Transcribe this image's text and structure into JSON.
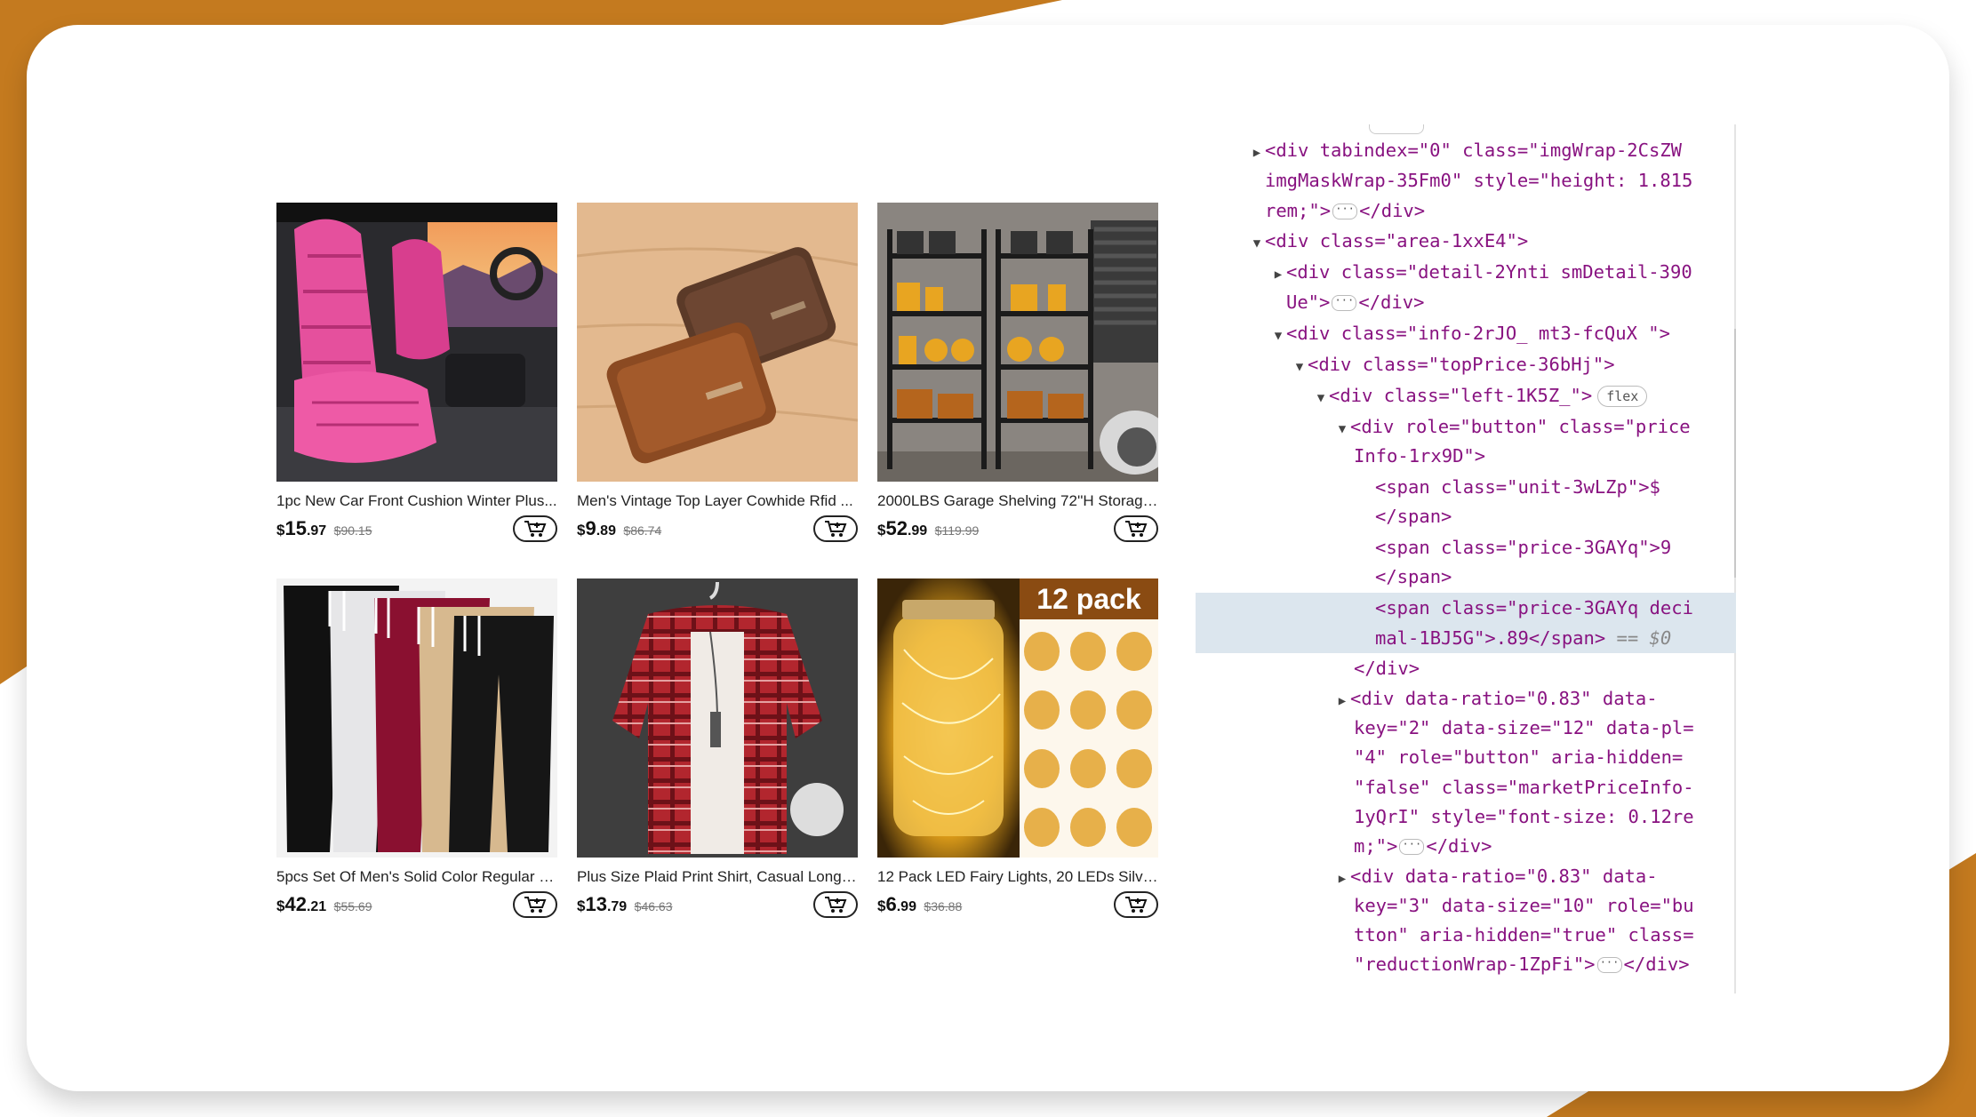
{
  "products": [
    {
      "title": "1pc New Car Front Cushion Winter Plus...",
      "currency": "$",
      "price_int": "15",
      "price_dec": ".97",
      "old_price": "$90.15"
    },
    {
      "title": "Men's Vintage Top Layer Cowhide Rfid ...",
      "currency": "$",
      "price_int": "9",
      "price_dec": ".89",
      "old_price": "$86.74"
    },
    {
      "title": "2000LBS Garage Shelving 72''H Storage...",
      "currency": "$",
      "price_int": "52",
      "price_dec": ".99",
      "old_price": "$119.99"
    },
    {
      "title": "5pcs Set Of Men's Solid Color Regular F...",
      "currency": "$",
      "price_int": "42",
      "price_dec": ".21",
      "old_price": "$55.69"
    },
    {
      "title": "Plus Size Plaid Print Shirt, Casual Long S...",
      "currency": "$",
      "price_int": "13",
      "price_dec": ".79",
      "old_price": "$46.63"
    },
    {
      "title": "12 Pack LED Fairy Lights, 20 LEDs Silver...",
      "currency": "$",
      "price_int": "6",
      "price_dec": ".99",
      "old_price": "$36.88",
      "badge": "12 pack"
    }
  ],
  "devtools": {
    "lines": [
      {
        "t": "<div tabindex=\"0\" class=\"imgWrap-2CsZW"
      },
      {
        "t": "imgMaskWrap-35Fm0\" style=\"height: 1.815"
      },
      {
        "t": "rem;\">"
      },
      {
        "t": "</div>"
      },
      {
        "t": "<div class=\"area-1xxE4\">"
      },
      {
        "t": "<div class=\"detail-2Ynti smDetail-390"
      },
      {
        "t": "Ue\">"
      },
      {
        "t": "</div>"
      },
      {
        "t": "<div class=\"info-2rJO_ mt3-fcQuX \">"
      },
      {
        "t": "<div class=\"topPrice-36bHj\">"
      },
      {
        "t": "<div class=\"left-1K5Z_\">"
      },
      {
        "t": "flex"
      },
      {
        "t": "<div role=\"button\" class=\"price"
      },
      {
        "t": "Info-1rx9D\">"
      },
      {
        "t": "<span class=\"unit-3wLZp\">$"
      },
      {
        "t": "</span>"
      },
      {
        "t": "<span class=\"price-3GAYq\">9"
      },
      {
        "t": "</span>"
      },
      {
        "t": "<span class=\"price-3GAYq deci"
      },
      {
        "t": "mal-1BJ5G\">.89</span>"
      },
      {
        "t": "== $0"
      },
      {
        "t": "</div>"
      },
      {
        "t": "<div data-ratio=\"0.83\" data-"
      },
      {
        "t": "key=\"2\" data-size=\"12\" data-pl="
      },
      {
        "t": "\"4\" role=\"button\" aria-hidden="
      },
      {
        "t": "\"false\" class=\"marketPriceInfo-"
      },
      {
        "t": "1yQrI\" style=\"font-size: 0.12re"
      },
      {
        "t": "m;\">"
      },
      {
        "t": "</div>"
      },
      {
        "t": "<div data-ratio=\"0.83\" data-"
      },
      {
        "t": "key=\"3\" data-size=\"10\" role=\"bu"
      },
      {
        "t": "tton\" aria-hidden=\"true\" class="
      },
      {
        "t": "\"reductionWrap-1ZpFi\">"
      },
      {
        "t": "</div>"
      }
    ]
  },
  "colors": {
    "brand_orange": "#c47a1f",
    "highlight": "#dce6ee"
  }
}
